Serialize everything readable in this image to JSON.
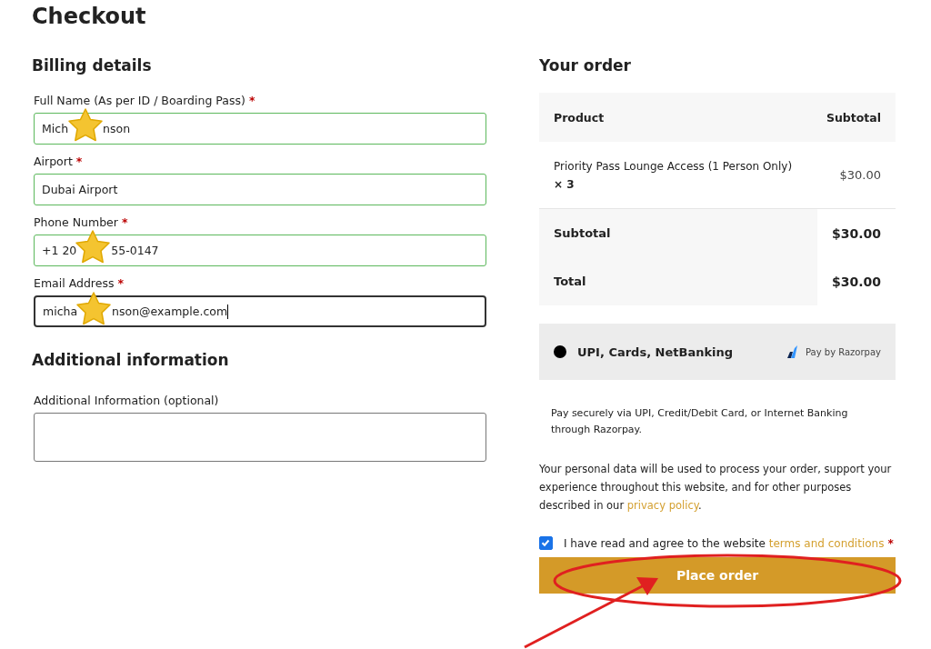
{
  "title": "Checkout",
  "billing": {
    "heading": "Billing details",
    "fields": [
      {
        "label": "Full Name (As per ID / Boarding Pass)",
        "required_mark": "*",
        "value_parts": [
          "Mich",
          "nson"
        ],
        "focused": false
      },
      {
        "label": "Airport",
        "required_mark": "*",
        "value_parts": [
          "Dubai Airport"
        ],
        "focused": false
      },
      {
        "label": "Phone Number",
        "required_mark": "*",
        "value_parts": [
          "+1 20",
          "55-0147"
        ],
        "focused": false
      },
      {
        "label": "Email Address",
        "required_mark": "*",
        "value_parts": [
          "micha",
          "nson@example.com"
        ],
        "focused": true
      }
    ]
  },
  "additional": {
    "heading": "Additional information",
    "label": "Additional Information (optional)"
  },
  "order": {
    "heading": "Your order",
    "columns": [
      "Product",
      "Subtotal"
    ],
    "items": [
      {
        "name": "Priority Pass Lounge Access (1 Person Only)",
        "quantity": "× 3",
        "price": "$30.00"
      }
    ],
    "totals": [
      {
        "label": "Subtotal",
        "value": "$30.00"
      },
      {
        "label": "Total",
        "value": "$30.00"
      }
    ]
  },
  "payment": {
    "method": "UPI, Cards, NetBanking",
    "selected": true,
    "provider": "Pay by Razorpay",
    "description": "Pay securely via UPI, Credit/Debit Card, or Internet Banking through Razorpay."
  },
  "privacy": {
    "text": "Your personal data will be used to process your order, support your experience throughout this website, and for other purposes described in our ",
    "link": "privacy policy",
    "end": "."
  },
  "terms": {
    "checked": true,
    "text": "I have read and agree to the website ",
    "link": "terms and conditions",
    "required_mark": "*"
  },
  "place_order": "Place order"
}
